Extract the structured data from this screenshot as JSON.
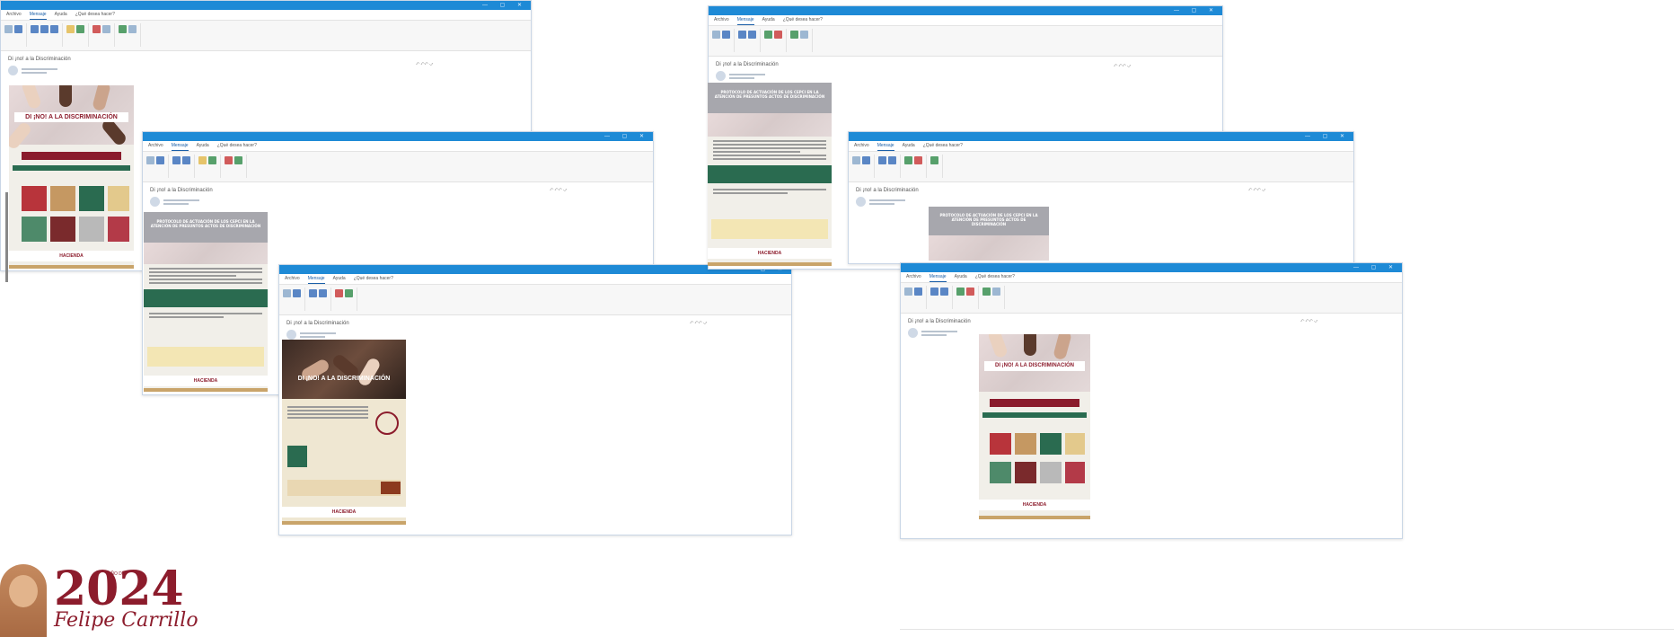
{
  "windows": [
    {
      "id": "w1",
      "subject": "Di ¡no! a la Discriminación",
      "tabs": [
        "Archivo",
        "Mensaje",
        "Ayuda",
        "¿Qué desea hacer?"
      ]
    },
    {
      "id": "w2",
      "subject": "Di ¡no! a la Discriminación",
      "tabs": [
        "Archivo",
        "Mensaje",
        "Ayuda",
        "¿Qué desea hacer?"
      ]
    },
    {
      "id": "w3",
      "subject": "Di ¡no! a la Discriminación",
      "tabs": [
        "Archivo",
        "Mensaje",
        "Ayuda",
        "¿Qué desea hacer?"
      ]
    },
    {
      "id": "w4",
      "subject": "Di ¡no! a la Discriminación",
      "tabs": [
        "Archivo",
        "Mensaje",
        "Ayuda",
        "¿Qué desea hacer?"
      ]
    },
    {
      "id": "w5",
      "subject": "Di ¡no! a la Discriminación",
      "tabs": [
        "Archivo",
        "Mensaje",
        "Ayuda",
        "¿Qué desea hacer?"
      ]
    },
    {
      "id": "w6",
      "subject": "Di ¡no! a la Discriminación",
      "tabs": [
        "Archivo",
        "Mensaje",
        "Ayuda",
        "¿Qué desea hacer?"
      ]
    }
  ],
  "posters": {
    "di_no": "DI ¡NO! A LA DISCRIMINACIÓN",
    "protocolo": "PROTOCOLO DE ACTUACIÓN DE LOS CEPCI EN LA ATENCIÓN DE PRESUNTOS ACTOS DE DISCRIMINACIÓN",
    "footer_brand": "HACIENDA"
  },
  "logo": {
    "year": "2024",
    "caption": "AÑO DE",
    "name": "Felipe Carrillo"
  },
  "colors": {
    "titlebar": "#1e8ad6",
    "guinda": "#8c1c2c",
    "green": "#2a6b50",
    "gold": "#c9a46a"
  }
}
